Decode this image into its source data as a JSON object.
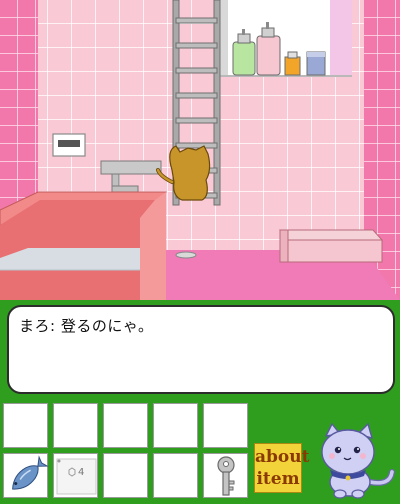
{
  "scene": {
    "description_key": "bathroom",
    "colors": {
      "tile_pink": "#f8c8d4",
      "wall_dark_pink": "#f07aa8",
      "floor_pink": "#f07bb6",
      "tub_pink": "#f08a8a",
      "water_blue": "#cfe0e6",
      "ladder_gray": "#a9a9a9"
    }
  },
  "dialog": {
    "text": "まろ: 登るのにゃ。"
  },
  "inventory": {
    "slots": [
      {
        "item": "",
        "icon": ""
      },
      {
        "item": "",
        "icon": ""
      },
      {
        "item": "",
        "icon": ""
      },
      {
        "item": "",
        "icon": ""
      },
      {
        "item": "",
        "icon": ""
      },
      {
        "item": "fish",
        "icon": "fish-icon"
      },
      {
        "item": "card",
        "icon": "card-icon",
        "badge": "4"
      },
      {
        "item": "",
        "icon": ""
      },
      {
        "item": "",
        "icon": ""
      },
      {
        "item": "key",
        "icon": "key-icon"
      }
    ]
  },
  "about_item": {
    "line1": "about",
    "line2": "item"
  }
}
